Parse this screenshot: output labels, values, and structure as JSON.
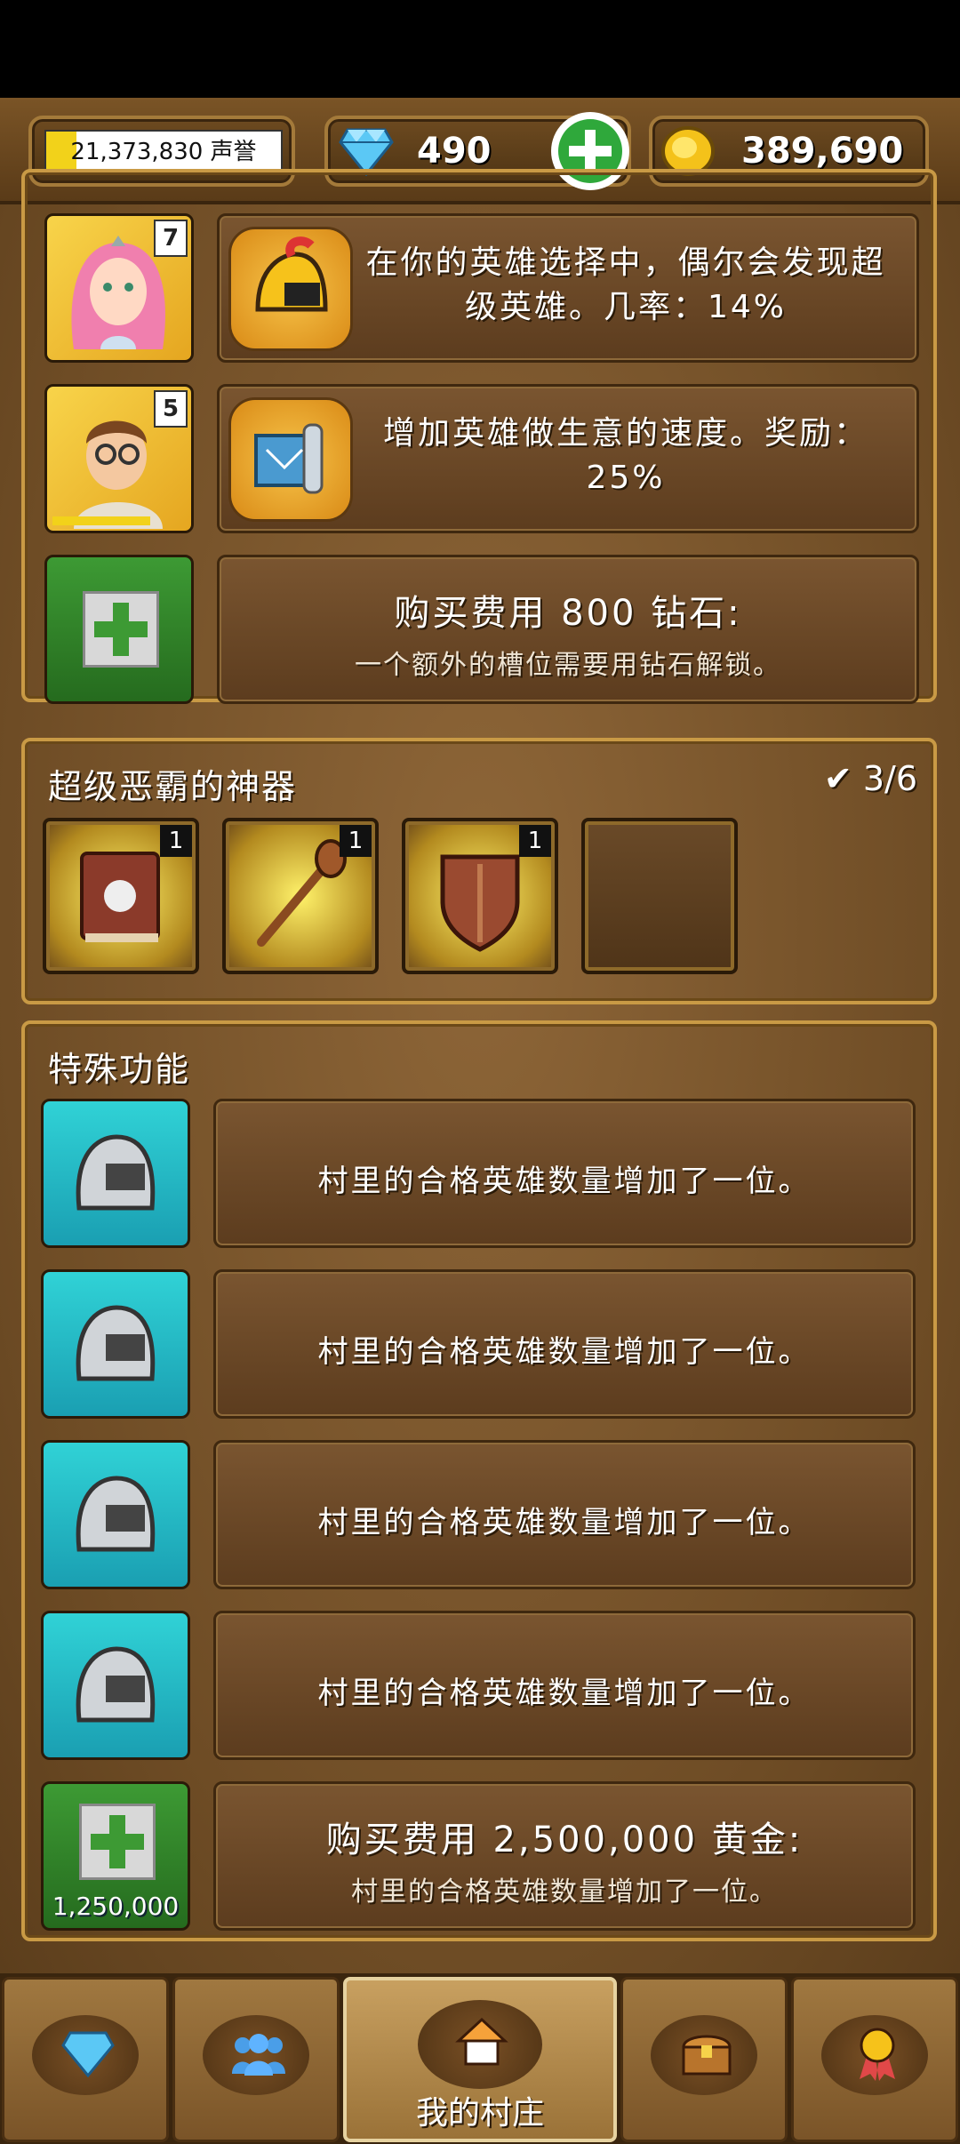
{
  "header": {
    "fame_value": "21,373,830",
    "fame_label": "声誉",
    "fame_text": "21,373,830 声誉",
    "fame_progress": 0.13,
    "gems": "490",
    "gold": "389,690"
  },
  "heroes": [
    {
      "level": "7",
      "portrait": "elf-princess-portrait",
      "ability_icon": "golden-helmet-icon",
      "text": "在你的英雄选择中，偶尔会发现超级英雄。几率：14%"
    },
    {
      "level": "5",
      "portrait": "merchant-hero-portrait",
      "ability_icon": "map-scroll-icon",
      "text": "增加英雄做生意的速度。奖励：25%"
    }
  ],
  "buy_slot": {
    "title": "购买费用 800 钻石:",
    "subtitle": "一个额外的槽位需要用钻石解锁。"
  },
  "artifacts": {
    "title": "超级恶霸的神器",
    "count": "3/6",
    "items": [
      {
        "name": "skull-book-icon",
        "count": "1"
      },
      {
        "name": "scepter-icon",
        "count": "1"
      },
      {
        "name": "shield-icon",
        "count": "1"
      }
    ]
  },
  "special": {
    "title": "特殊功能",
    "features": [
      "村里的合格英雄数量增加了一位。",
      "村里的合格英雄数量增加了一位。",
      "村里的合格英雄数量增加了一位。",
      "村里的合格英雄数量增加了一位。"
    ],
    "buy": {
      "price_tag": "1,250,000",
      "title": "购买费用 2,500,000 黄金:",
      "subtitle": "村里的合格英雄数量增加了一位。"
    }
  },
  "nav": {
    "tabs": [
      "diamond-icon",
      "heroes-icon",
      "home-icon",
      "treasure-chest-icon",
      "medal-icon"
    ],
    "active_label": "我的村庄"
  },
  "colors": {
    "accent_gold": "#c99a45",
    "green": "#2fa83b",
    "cyan": "#30d2d6",
    "wood": "#6e4c25"
  }
}
